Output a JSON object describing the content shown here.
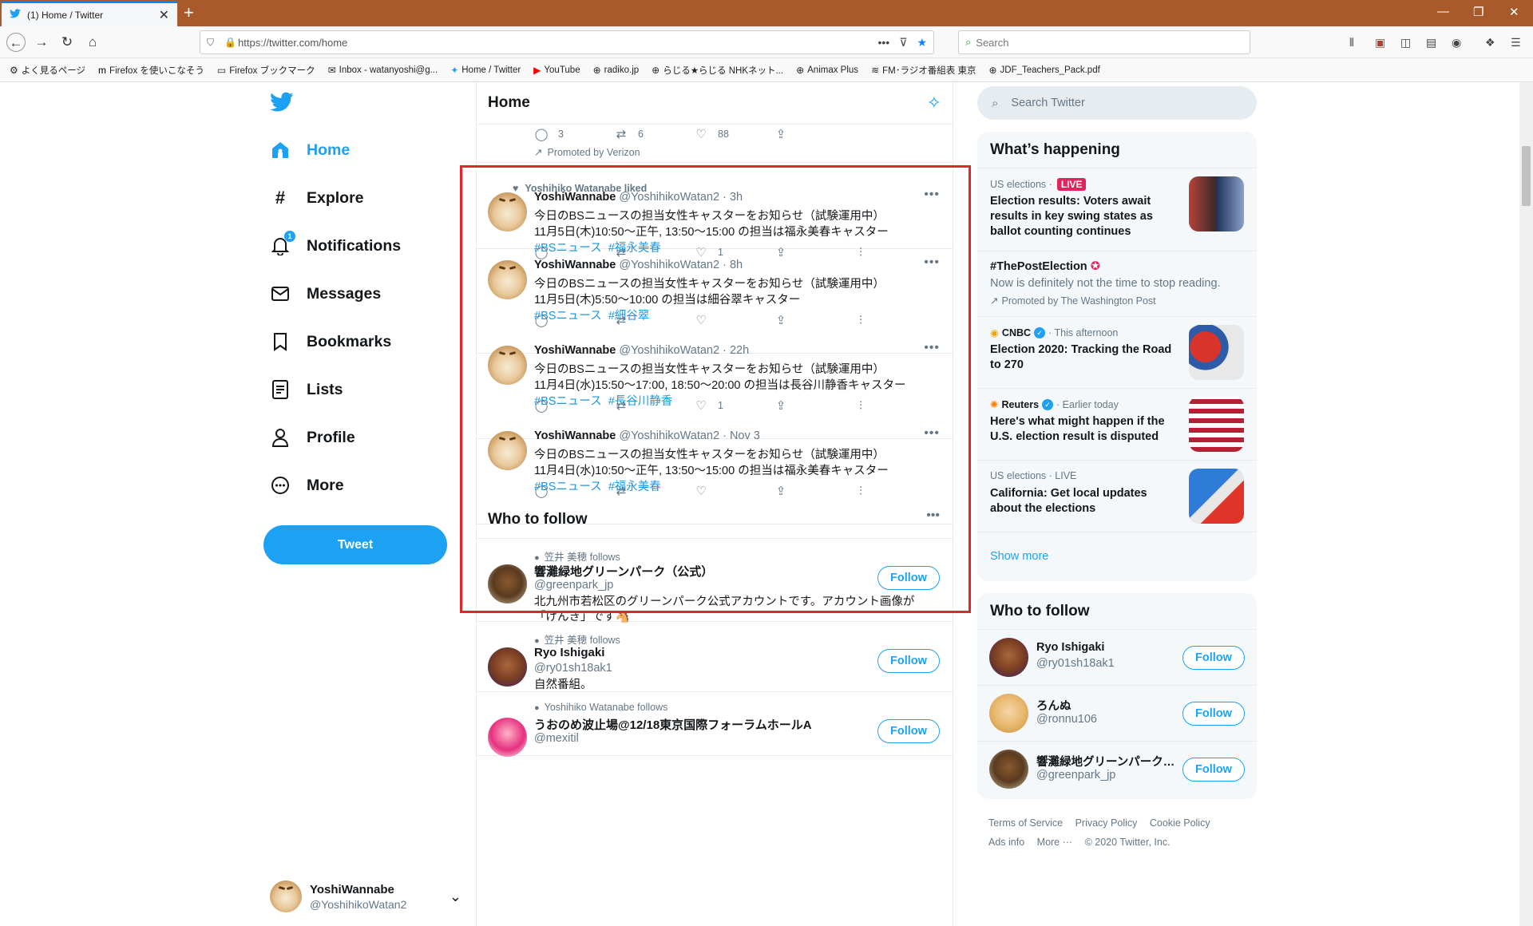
{
  "browser": {
    "tab_title": "(1) Home / Twitter",
    "new_tab": "+",
    "url": "https://twitter.com/home",
    "search_placeholder": "Search",
    "bookmarks": [
      {
        "label": "よく見るページ",
        "icon": "gear-icon"
      },
      {
        "label": "Firefox を使いこなそう",
        "icon": "m-icon"
      },
      {
        "label": "Firefox ブックマーク",
        "icon": "folder-icon"
      },
      {
        "label": "Inbox - watanyoshi@g...",
        "icon": "mail-icon"
      },
      {
        "label": "Home / Twitter",
        "icon": "twitter-icon"
      },
      {
        "label": "YouTube",
        "icon": "youtube-icon"
      },
      {
        "label": "radiko.jp",
        "icon": "globe-icon"
      },
      {
        "label": "らじる★らじる NHKネット...",
        "icon": "globe-icon"
      },
      {
        "label": "Animax Plus",
        "icon": "globe-icon"
      },
      {
        "label": "FM･ラジオ番組表 東京",
        "icon": "wave-icon"
      },
      {
        "label": "JDF_Teachers_Pack.pdf",
        "icon": "globe-icon"
      }
    ]
  },
  "nav": {
    "items": [
      {
        "label": "Home",
        "icon": "home-icon"
      },
      {
        "label": "Explore",
        "icon": "hashtag-icon"
      },
      {
        "label": "Notifications",
        "icon": "bell-icon",
        "badge": "1"
      },
      {
        "label": "Messages",
        "icon": "mail-icon"
      },
      {
        "label": "Bookmarks",
        "icon": "bookmark-icon"
      },
      {
        "label": "Lists",
        "icon": "list-icon"
      },
      {
        "label": "Profile",
        "icon": "person-icon"
      },
      {
        "label": "More",
        "icon": "more-circle-icon"
      }
    ],
    "tweet_button": "Tweet",
    "account": {
      "name": "YoshiWannabe",
      "handle": "@YoshihikoWatan2"
    }
  },
  "timeline": {
    "title": "Home",
    "promoted": {
      "replies": "3",
      "retweets": "6",
      "likes": "88",
      "label": "Promoted by Verizon"
    },
    "liked_by": "Yoshihiko Watanabe liked",
    "tweets": [
      {
        "name": "YoshiWannabe",
        "meta": "@YoshihikoWatan2 · 3h",
        "line1": "今日のBSニュースの担当女性キャスターをお知らせ（試験運用中）",
        "line2": "11月5日(木)10:50～正午, 13:50～15:00 の担当は福永美春キャスター",
        "tags": [
          "#BSニュース",
          "#福永美春"
        ],
        "likes": "1"
      },
      {
        "name": "YoshiWannabe",
        "meta": "@YoshihikoWatan2 · 8h",
        "line1": "今日のBSニュースの担当女性キャスターをお知らせ（試験運用中）",
        "line2": "11月5日(木)5:50～10:00 の担当は細谷翠キャスター",
        "tags": [
          "#BSニュース",
          "#細谷翠"
        ],
        "likes": ""
      },
      {
        "name": "YoshiWannabe",
        "meta": "@YoshihikoWatan2 · 22h",
        "line1": "今日のBSニュースの担当女性キャスターをお知らせ（試験運用中）",
        "line2": "11月4日(水)15:50～17:00, 18:50～20:00 の担当は長谷川静香キャスター",
        "tags": [
          "#BSニュース",
          "#長谷川静香"
        ],
        "likes": "1"
      },
      {
        "name": "YoshiWannabe",
        "meta": "@YoshihikoWatan2 · Nov 3",
        "line1": "今日のBSニュースの担当女性キャスターをお知らせ（試験運用中）",
        "line2": "11月4日(水)10:50～正午, 13:50～15:00 の担当は福永美春キャスター",
        "tags": [
          "#BSニュース",
          "#福永美春"
        ],
        "likes": ""
      }
    ],
    "who_to_follow": {
      "title": "Who to follow",
      "items": [
        {
          "follows": "笠井 美穂 follows",
          "name": "響灘緑地グリーンパーク（公式）",
          "handle": "@greenpark_jp",
          "bio1": "北九州市若松区のグリーンパーク公式アカウントです。アカウント画像が",
          "bio2": "「げんき」です🐴",
          "button": "Follow"
        },
        {
          "follows": "笠井 美穂 follows",
          "name": "Ryo Ishigaki",
          "handle": "@ry01sh18ak1",
          "bio1": "自然番組。",
          "bio2": "",
          "button": "Follow"
        },
        {
          "follows": "Yoshihiko Watanabe follows",
          "name": "うおのめ波止場@12/18東京国際フォーラムホールA",
          "handle": "@mexitil",
          "bio1": "",
          "bio2": "",
          "button": "Follow"
        }
      ]
    }
  },
  "sidebar": {
    "search_placeholder": "Search Twitter",
    "happening_title": "What’s happening",
    "trends": [
      {
        "meta": "US elections · ",
        "live": "LIVE",
        "title": "Election results: Voters await results in key swing states as ballot counting continues"
      },
      {
        "meta": "",
        "title": "#ThePostElection",
        "desc": "Now is definitely not the time to stop reading.",
        "promoted": "Promoted by The Washington Post"
      },
      {
        "source": "CNBC",
        "meta": "· This afternoon",
        "title": "Election 2020: Tracking the Road to 270"
      },
      {
        "source": "Reuters",
        "meta": "· Earlier today",
        "title": "Here's what might happen if the U.S. election result is disputed"
      },
      {
        "meta": "US elections · LIVE",
        "title": "California: Get local updates about the elections"
      }
    ],
    "show_more": "Show more",
    "wtf_title": "Who to follow",
    "wtf": [
      {
        "name": "Ryo Ishigaki",
        "handle": "@ry01sh18ak1",
        "button": "Follow"
      },
      {
        "name": "ろんぬ",
        "handle": "@ronnu106",
        "button": "Follow"
      },
      {
        "name": "響灘緑地グリーンパーク（公式）",
        "handle": "@greenpark_jp",
        "button": "Follow"
      }
    ],
    "footer": {
      "links1": [
        "Terms of Service",
        "Privacy Policy",
        "Cookie Policy"
      ],
      "links2": [
        "Ads info",
        "More ···",
        "© 2020 Twitter, Inc."
      ]
    }
  },
  "colors": {
    "accent": "#1da1f2",
    "highlight_box": "#e3242b",
    "titlebar": "#a85a2a"
  }
}
